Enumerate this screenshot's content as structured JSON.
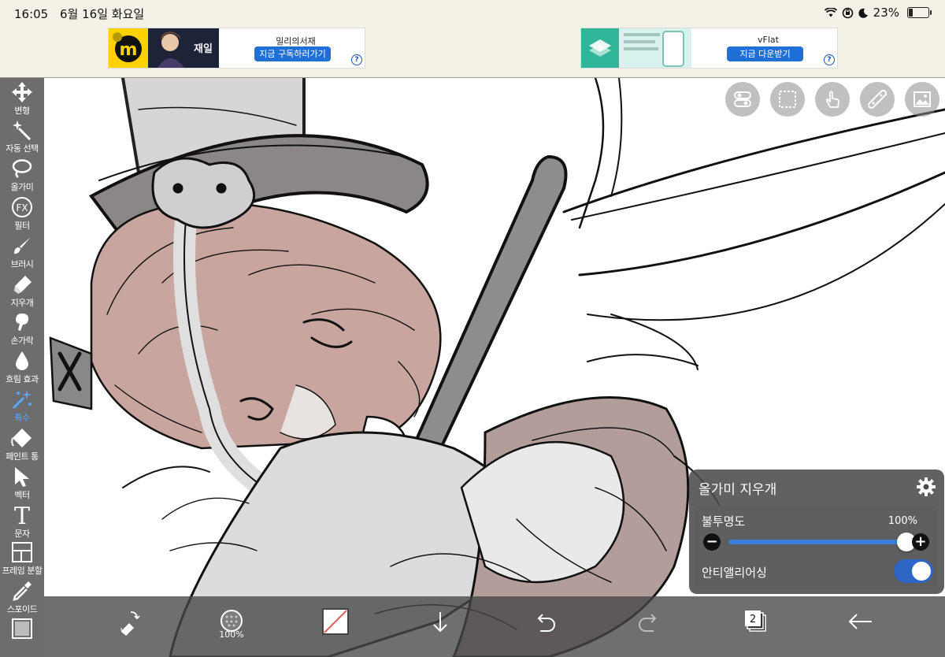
{
  "status_bar": {
    "time": "16:05",
    "date": "6월 16일 화요일",
    "battery_pct": "23%",
    "battery_level": 0.23,
    "icons": [
      "wifi-icon",
      "orientation-lock-icon",
      "moon-icon",
      "battery-icon"
    ]
  },
  "ads": [
    {
      "logo_letter": "m",
      "thumb_text": "재일",
      "title": "밀리의서재",
      "cta": "지금 구독하러가기",
      "info": "?"
    },
    {
      "title": "vFlat",
      "cta": "지금 다운받기",
      "info": "?"
    }
  ],
  "toolbar": {
    "tools": [
      {
        "label": "변형",
        "icon": "move-arrows-icon"
      },
      {
        "label": "자동 선택",
        "icon": "magic-wand-icon"
      },
      {
        "label": "올가미",
        "icon": "lasso-icon"
      },
      {
        "label": "필터",
        "icon": "fx-icon",
        "icon_text": "FX"
      },
      {
        "label": "브러시",
        "icon": "brush-icon"
      },
      {
        "label": "지우개",
        "icon": "eraser-icon"
      },
      {
        "label": "손가락",
        "icon": "smudge-finger-icon"
      },
      {
        "label": "흐림 효과",
        "icon": "blur-drop-icon"
      },
      {
        "label": "특수",
        "icon": "special-sparkle-icon",
        "active": true
      },
      {
        "label": "페인트 통",
        "icon": "paint-bucket-icon"
      },
      {
        "label": "벡터",
        "icon": "vector-cursor-icon"
      },
      {
        "label": "문자",
        "icon": "text-icon",
        "icon_text": "T"
      },
      {
        "label": "프레임 분할",
        "icon": "frame-divide-icon"
      },
      {
        "label": "스포이드",
        "icon": "eyedropper-icon"
      },
      {
        "label": "",
        "icon": "canvas-frame-icon"
      }
    ],
    "active_color": "#5aa8ff"
  },
  "top_buttons": [
    "toggle-settings-icon",
    "selection-icon",
    "hand-gesture-icon",
    "ruler-icon",
    "image-icon"
  ],
  "bottom_bar": {
    "items": [
      {
        "name": "swap-tool-icon"
      },
      {
        "name": "brush-size-icon",
        "text": "100%"
      },
      {
        "name": "color-swatch",
        "color": "#e06060"
      },
      {
        "name": "download-arrow-icon"
      },
      {
        "name": "undo-icon"
      },
      {
        "name": "redo-icon"
      },
      {
        "name": "layers-icon",
        "text": "2"
      },
      {
        "name": "back-arrow-icon"
      }
    ]
  },
  "panel": {
    "title": "올가미 지우개",
    "opacity_label": "불투명도",
    "opacity_value": "100%",
    "opacity_fraction": 1.0,
    "minus": "−",
    "plus": "+",
    "antialias_label": "안티앨리어싱",
    "antialias_on": true
  },
  "colors": {
    "toolbar_bg": "#6d6d6d",
    "accent": "#3a7fd8",
    "hair": "#c9a5a0",
    "gray_fill": "#d6d6d6"
  }
}
